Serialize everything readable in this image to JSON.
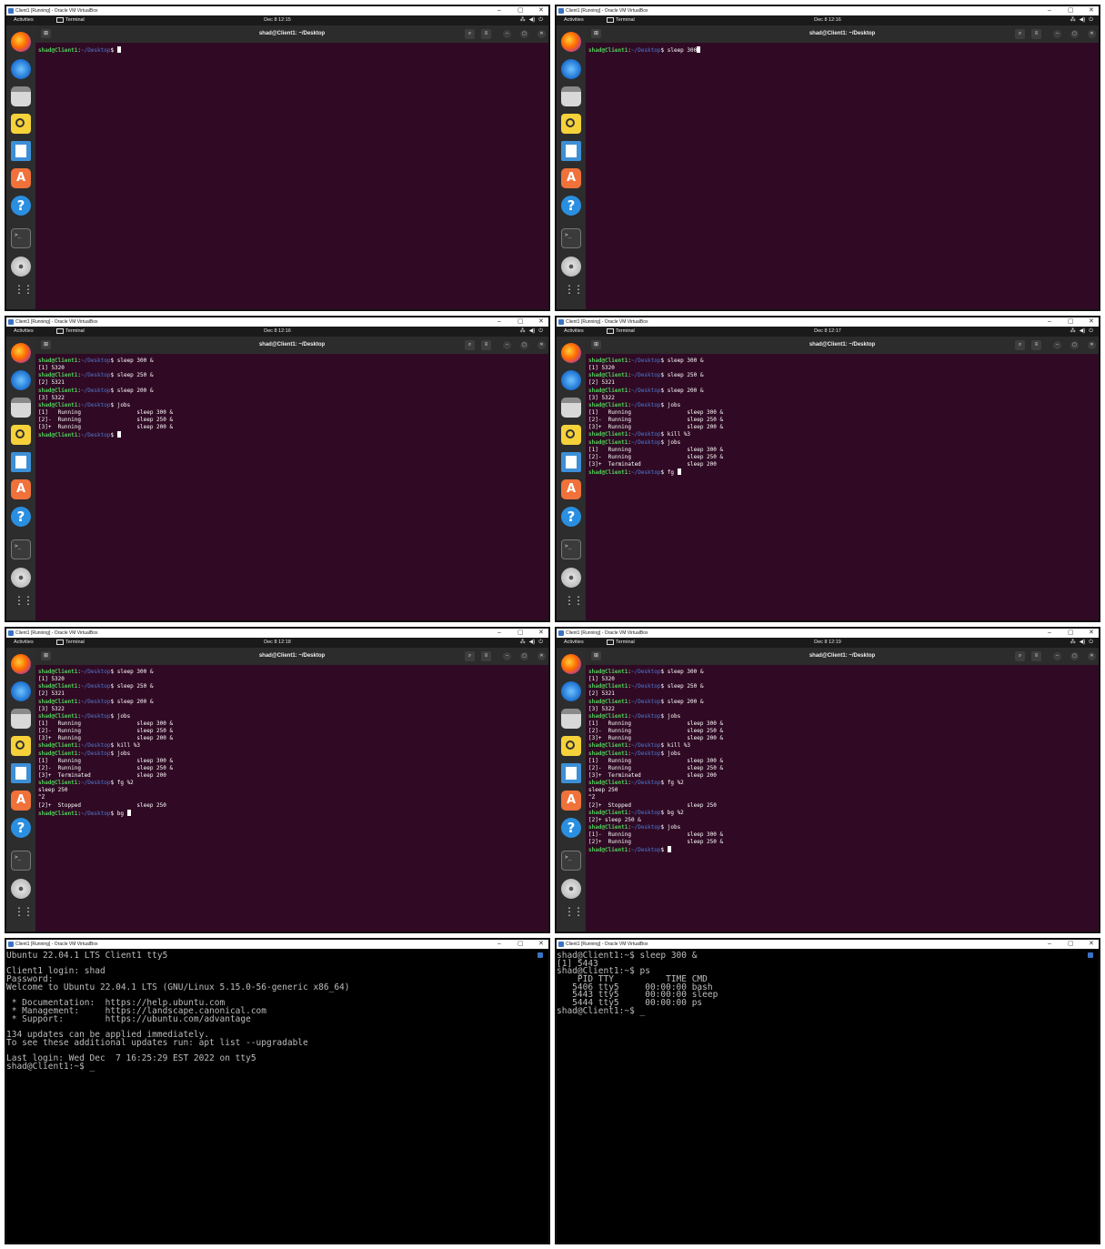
{
  "vbox": {
    "title": "Client1 [Running] - Oracle VM VirtualBox",
    "minimize": "–",
    "restore": "▢",
    "close": "✕"
  },
  "gnome": {
    "activities": "Activities",
    "app_name": "Terminal",
    "tray_network": "⁂",
    "tray_volume": "◀)",
    "tray_power": "⏻"
  },
  "terminal_title": "shad@Client1: ~/Desktop",
  "header_icons": {
    "new_tab": "⊞",
    "search": "⌕",
    "menu": "≡",
    "minimize": "–",
    "maximize": "▢",
    "close": "✕"
  },
  "prompt": {
    "user": "shad@Client1",
    "sep": ":",
    "path": "~/Desktop",
    "dollar": "$"
  },
  "panels": [
    {
      "clock": "Dec 8  12:15",
      "lines": [
        {
          "p": true,
          "cmd": " ",
          "cursor": true
        }
      ]
    },
    {
      "clock": "Dec 8  12:16",
      "lines": [
        {
          "p": true,
          "cmd": " sleep 300",
          "cursor": true
        }
      ]
    },
    {
      "clock": "Dec 8  12:16",
      "lines": [
        {
          "p": true,
          "cmd": " sleep 300 &"
        },
        {
          "out": "[1] 5320"
        },
        {
          "p": true,
          "cmd": " sleep 250 &"
        },
        {
          "out": "[2] 5321"
        },
        {
          "p": true,
          "cmd": " sleep 200 &"
        },
        {
          "out": "[3] 5322"
        },
        {
          "p": true,
          "cmd": " jobs"
        },
        {
          "out": "[1]   Running                 sleep 300 &"
        },
        {
          "out": "[2]-  Running                 sleep 250 &"
        },
        {
          "out": "[3]+  Running                 sleep 200 &"
        },
        {
          "p": true,
          "cmd": " ",
          "cursor": true
        }
      ]
    },
    {
      "clock": "Dec 8  12:17",
      "lines": [
        {
          "p": true,
          "cmd": " sleep 300 &"
        },
        {
          "out": "[1] 5320"
        },
        {
          "p": true,
          "cmd": " sleep 250 &"
        },
        {
          "out": "[2] 5321"
        },
        {
          "p": true,
          "cmd": " sleep 200 &"
        },
        {
          "out": "[3] 5322"
        },
        {
          "p": true,
          "cmd": " jobs"
        },
        {
          "out": "[1]   Running                 sleep 300 &"
        },
        {
          "out": "[2]-  Running                 sleep 250 &"
        },
        {
          "out": "[3]+  Running                 sleep 200 &"
        },
        {
          "p": true,
          "cmd": " kill %3"
        },
        {
          "p": true,
          "cmd": " jobs"
        },
        {
          "out": "[1]   Running                 sleep 300 &"
        },
        {
          "out": "[2]-  Running                 sleep 250 &"
        },
        {
          "out": "[3]+  Terminated              sleep 200"
        },
        {
          "p": true,
          "cmd": " fg ",
          "cursor": true
        }
      ]
    },
    {
      "clock": "Dec 8  12:18",
      "lines": [
        {
          "p": true,
          "cmd": " sleep 300 &"
        },
        {
          "out": "[1] 5320"
        },
        {
          "p": true,
          "cmd": " sleep 250 &"
        },
        {
          "out": "[2] 5321"
        },
        {
          "p": true,
          "cmd": " sleep 200 &"
        },
        {
          "out": "[3] 5322"
        },
        {
          "p": true,
          "cmd": " jobs"
        },
        {
          "out": "[1]   Running                 sleep 300 &"
        },
        {
          "out": "[2]-  Running                 sleep 250 &"
        },
        {
          "out": "[3]+  Running                 sleep 200 &"
        },
        {
          "p": true,
          "cmd": " kill %3"
        },
        {
          "p": true,
          "cmd": " jobs"
        },
        {
          "out": "[1]   Running                 sleep 300 &"
        },
        {
          "out": "[2]-  Running                 sleep 250 &"
        },
        {
          "out": "[3]+  Terminated              sleep 200"
        },
        {
          "p": true,
          "cmd": " fg %2"
        },
        {
          "out": "sleep 250"
        },
        {
          "out": "^Z"
        },
        {
          "out": "[2]+  Stopped                 sleep 250"
        },
        {
          "p": true,
          "cmd": " bg ",
          "cursor": true
        }
      ]
    },
    {
      "clock": "Dec 8  12:19",
      "lines": [
        {
          "p": true,
          "cmd": " sleep 300 &"
        },
        {
          "out": "[1] 5320"
        },
        {
          "p": true,
          "cmd": " sleep 250 &"
        },
        {
          "out": "[2] 5321"
        },
        {
          "p": true,
          "cmd": " sleep 200 &"
        },
        {
          "out": "[3] 5322"
        },
        {
          "p": true,
          "cmd": " jobs"
        },
        {
          "out": "[1]   Running                 sleep 300 &"
        },
        {
          "out": "[2]-  Running                 sleep 250 &"
        },
        {
          "out": "[3]+  Running                 sleep 200 &"
        },
        {
          "p": true,
          "cmd": " kill %3"
        },
        {
          "p": true,
          "cmd": " jobs"
        },
        {
          "out": "[1]   Running                 sleep 300 &"
        },
        {
          "out": "[2]-  Running                 sleep 250 &"
        },
        {
          "out": "[3]+  Terminated              sleep 200"
        },
        {
          "p": true,
          "cmd": " fg %2"
        },
        {
          "out": "sleep 250"
        },
        {
          "out": "^Z"
        },
        {
          "out": "[2]+  Stopped                 sleep 250"
        },
        {
          "p": true,
          "cmd": " bg %2"
        },
        {
          "out": "[2]+ sleep 250 &"
        },
        {
          "p": true,
          "cmd": " jobs"
        },
        {
          "out": "[1]-  Running                 sleep 300 &"
        },
        {
          "out": "[2]+  Running                 sleep 250 &"
        },
        {
          "p": true,
          "cmd": " ",
          "cursor": true
        }
      ]
    }
  ],
  "tty_panels": [
    {
      "lines": [
        "Ubuntu 22.04.1 LTS Client1 tty5",
        "",
        "Client1 login: shad",
        "Password:",
        "Welcome to Ubuntu 22.04.1 LTS (GNU/Linux 5.15.0-56-generic x86_64)",
        "",
        " * Documentation:  https://help.ubuntu.com",
        " * Management:     https://landscape.canonical.com",
        " * Support:        https://ubuntu.com/advantage",
        "",
        "134 updates can be applied immediately.",
        "To see these additional updates run: apt list --upgradable",
        "",
        "Last login: Wed Dec  7 16:25:29 EST 2022 on tty5",
        "shad@Client1:~$ _"
      ]
    },
    {
      "lines": [
        "shad@Client1:~$ sleep 300 &",
        "[1] 5443",
        "shad@Client1:~$ ps",
        "    PID TTY          TIME CMD",
        "   5406 tty5     00:00:00 bash",
        "   5443 tty5     00:00:00 sleep",
        "   5444 tty5     00:00:00 ps",
        "shad@Client1:~$ _"
      ]
    }
  ],
  "colors": {
    "terminal_bg": "#300a24",
    "prompt_user": "#4fd15a",
    "prompt_path": "#4c7ad6",
    "topbar": "#1a1a1a",
    "dock": "#2d2d2d"
  },
  "dock_icons": [
    "firefox-icon",
    "thunderbird-mail-icon",
    "files-icon",
    "rhythmbox-icon",
    "libreoffice-writer-icon",
    "app-center-icon",
    "help-icon",
    "terminal-icon",
    "disc-icon",
    "show-apps-icon"
  ]
}
